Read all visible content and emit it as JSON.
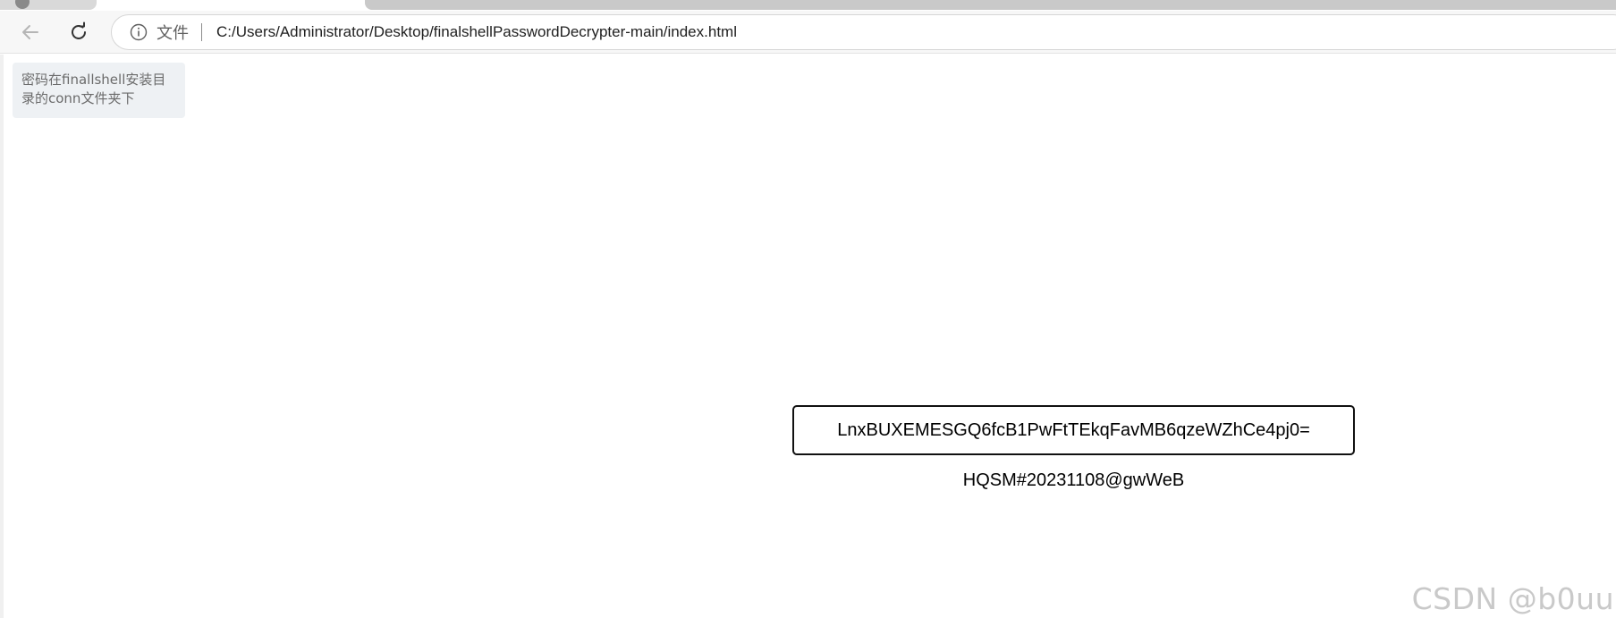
{
  "browser": {
    "address_bar": {
      "scheme_label": "文件",
      "url": "C:/Users/Administrator/Desktop/finalshellPasswordDecrypter-main/index.html"
    },
    "icons": {
      "back": "back-arrow-icon",
      "reload": "reload-icon",
      "info": "info-icon"
    }
  },
  "page": {
    "tip_text": "密码在finallshell安装目录的conn文件夹下",
    "encrypted_input": {
      "value": "LnxBUXEMESGQ6fcB1PwFtTEkqFavMB6qzeWZhCe4pj0=",
      "placeholder": ""
    },
    "decrypted_result": "HQSM#20231108@gwWeB"
  },
  "watermark": "CSDN @b0uu",
  "colors": {
    "toolbar_bg": "#f7f7f7",
    "tip_bg": "#eef1f4",
    "input_border": "#111111",
    "watermark": "#c9c9c9"
  }
}
